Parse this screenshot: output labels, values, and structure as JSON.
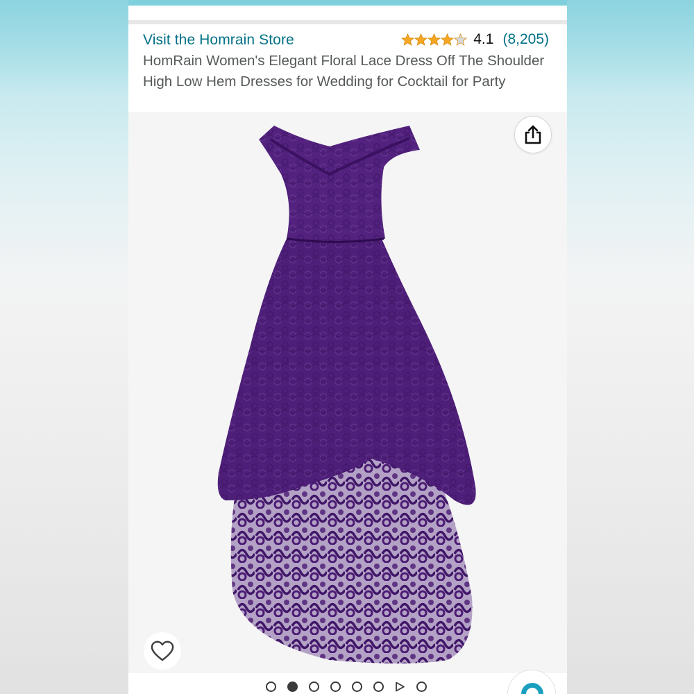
{
  "store": {
    "link_text": "Visit the Homrain Store"
  },
  "rating": {
    "stars_value": 4.1,
    "stars_max": 5,
    "value_text": "4.1",
    "count_text": "(8,205)",
    "star_color": "#f5a623",
    "star_empty_color": "#d5d9d9"
  },
  "product": {
    "title": "HomRain Women's Elegant Floral Lace Dress Off The Shoulder High Low Hem Dresses for Wedding for Cocktail for Party",
    "image_color": "#4e1f78"
  },
  "gallery": {
    "total_slides": 8,
    "active_index": 1,
    "video_slide_index": 6
  },
  "icons": {
    "share": "share-icon",
    "heart": "heart-icon",
    "play": "play-icon"
  },
  "colors": {
    "link": "#007185",
    "text": "#565959",
    "accent_fab": "#1a9fbf"
  }
}
